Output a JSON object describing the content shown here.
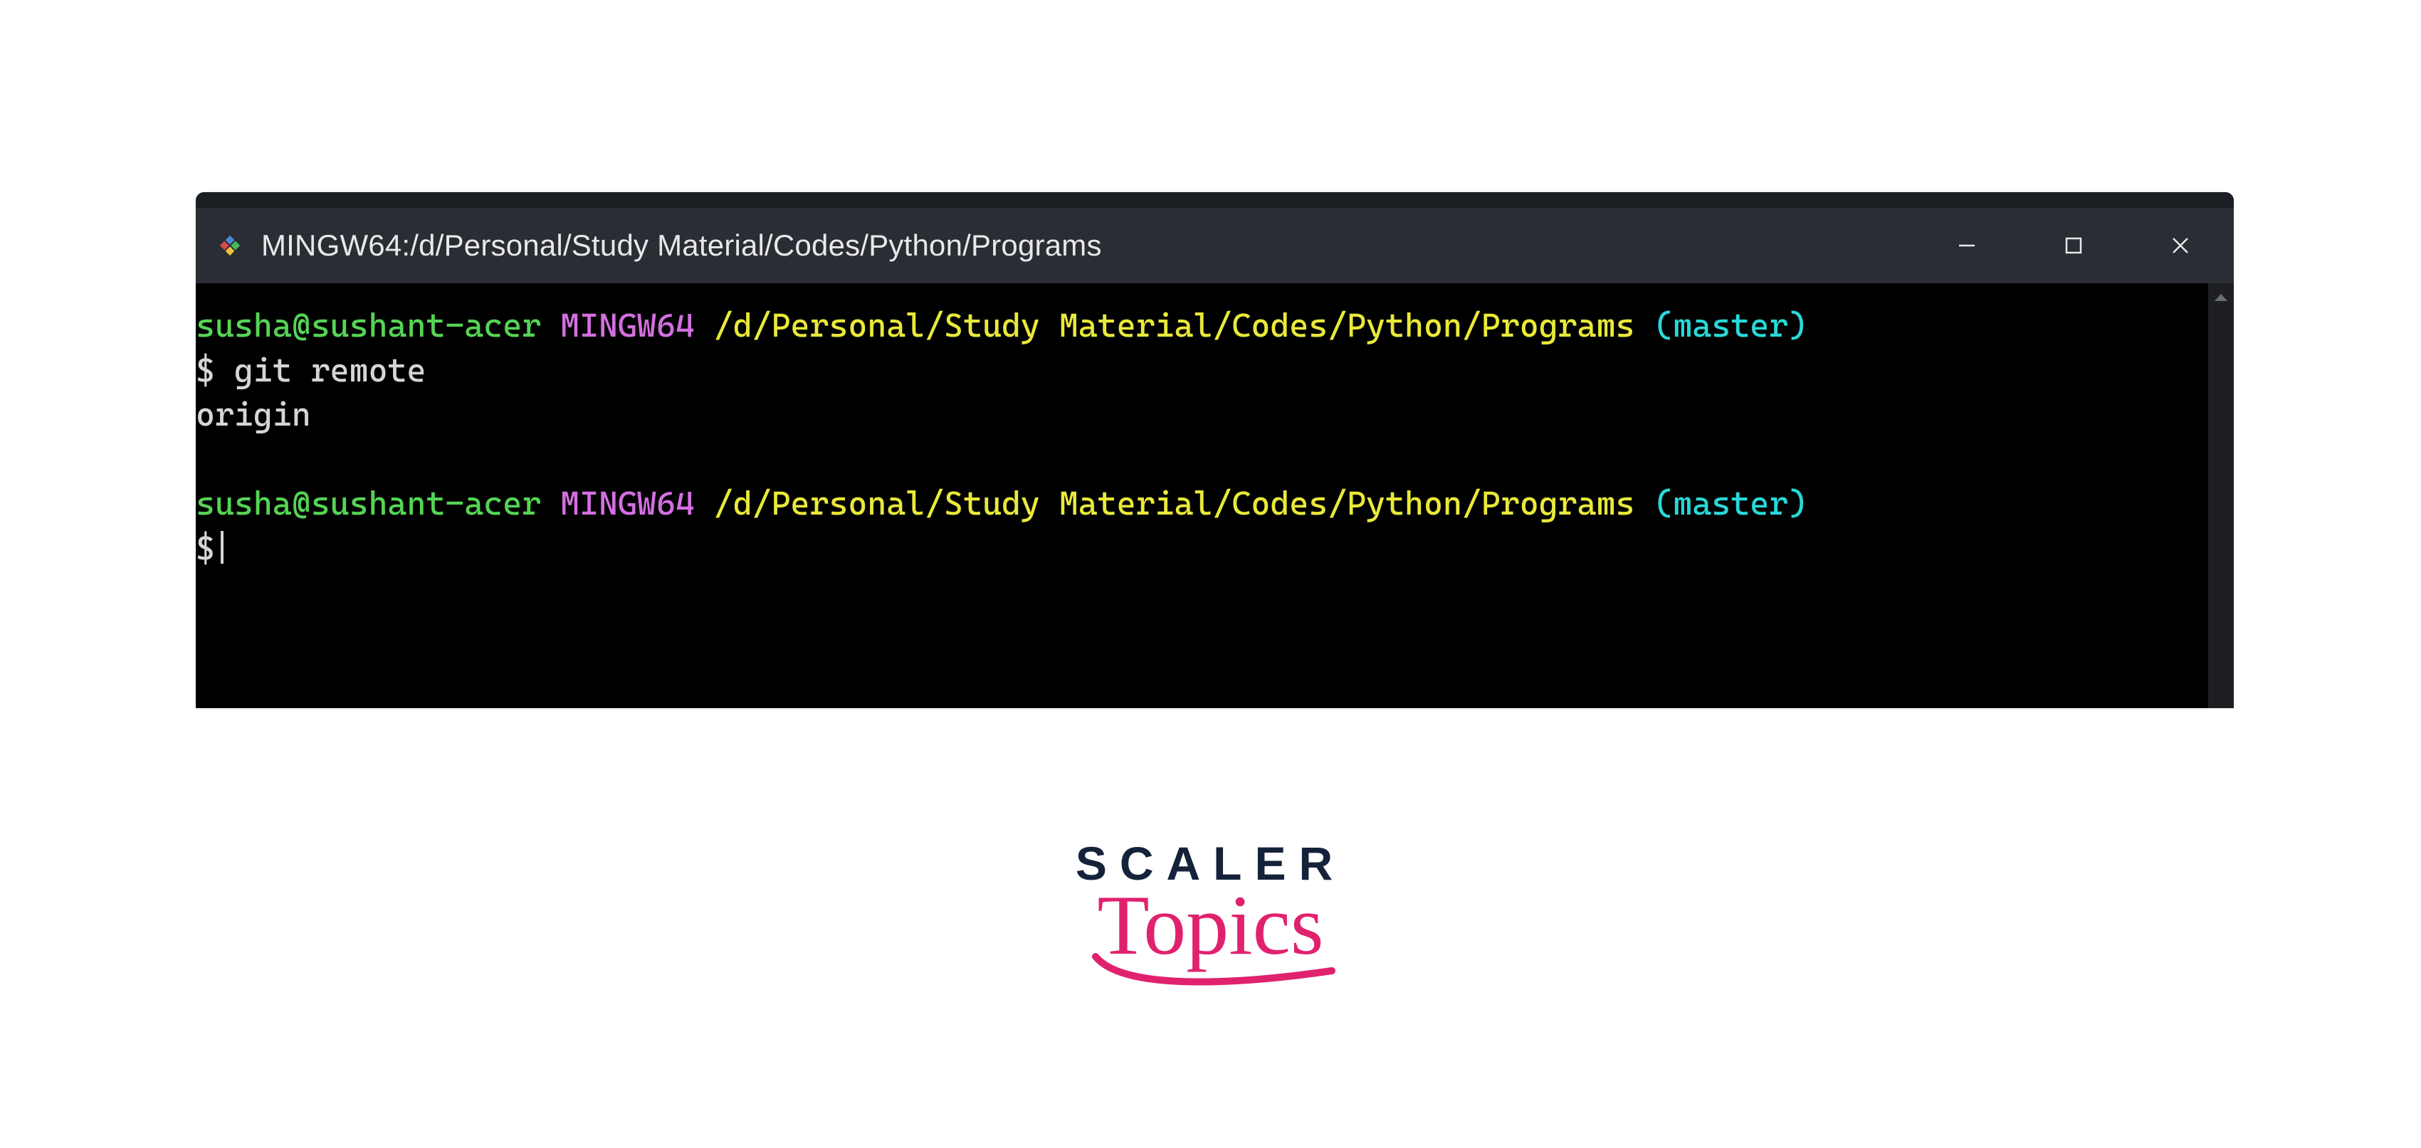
{
  "window": {
    "title": "MINGW64:/d/Personal/Study Material/Codes/Python/Programs",
    "icon_name": "mingw-logo",
    "controls": {
      "minimize": "minimize",
      "maximize": "maximize",
      "close": "close"
    }
  },
  "prompt": {
    "user": "susha@sushant-acer",
    "host": "MINGW64",
    "path": "/d/Personal/Study Material/Codes/Python/Programs",
    "branch": "(master)",
    "symbol": "$"
  },
  "session": {
    "command1": "git remote",
    "output1": "origin"
  },
  "brand": {
    "main": "SCALER",
    "sub": "Topics"
  },
  "colors": {
    "titlebar_bg": "#2a2d33",
    "terminal_bg": "#000000",
    "user": "#55d455",
    "host": "#d36fe0",
    "path": "#e9e93a",
    "branch": "#29d8d8",
    "text": "#d5d5d5",
    "brand_main": "#14223a",
    "brand_sub": "#e0226e"
  }
}
